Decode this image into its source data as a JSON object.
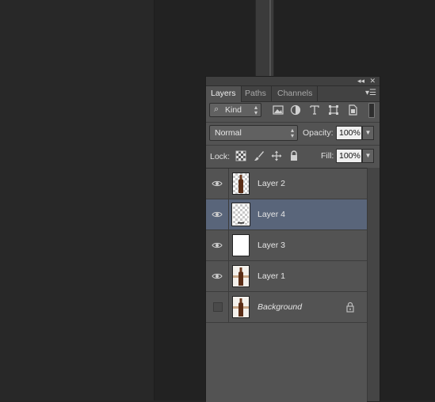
{
  "panel": {
    "collapse_glyph": "◂◂",
    "close_glyph": "✕",
    "menu_glyph": "▾☰",
    "tabs": [
      {
        "label": "Layers",
        "active": true
      },
      {
        "label": "Paths",
        "active": false
      },
      {
        "label": "Channels",
        "active": false
      }
    ]
  },
  "filter": {
    "kind_label": "Kind",
    "icons": [
      "image-filter-icon",
      "adjustment-filter-icon",
      "type-filter-icon",
      "shape-filter-icon",
      "smart-object-filter-icon"
    ]
  },
  "blend": {
    "mode": "Normal",
    "opacity_label": "Opacity:",
    "opacity_value": "100%",
    "fill_label": "Fill:",
    "fill_value": "100%",
    "lock_label": "Lock:"
  },
  "layers": [
    {
      "name": "Layer 2",
      "visible": true,
      "selected": false,
      "thumb": "bottle-transparent"
    },
    {
      "name": "Layer 4",
      "visible": true,
      "selected": true,
      "thumb": "transparent"
    },
    {
      "name": "Layer 3",
      "visible": true,
      "selected": false,
      "thumb": "white"
    },
    {
      "name": "Layer 1",
      "visible": true,
      "selected": false,
      "thumb": "bottle-photo"
    },
    {
      "name": "Background",
      "visible": false,
      "selected": false,
      "thumb": "bottle-photo",
      "locked": true
    }
  ],
  "colors": {
    "panel_bg": "#535353",
    "selected_row": "#59657a",
    "workspace_bg": "#262626"
  }
}
